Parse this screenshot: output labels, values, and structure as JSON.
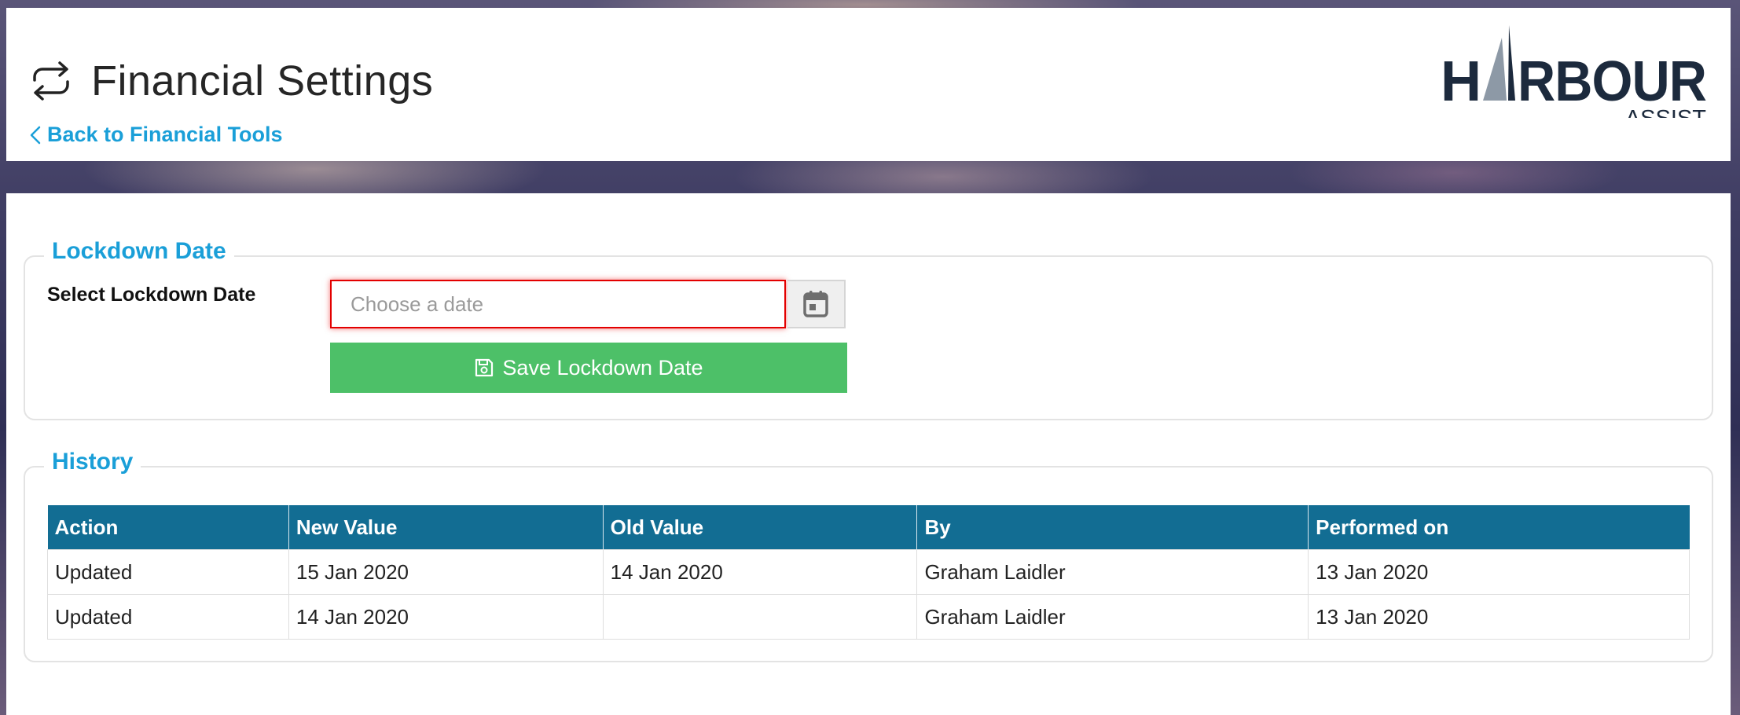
{
  "header": {
    "title": "Financial Settings",
    "title_icon": "repeat-arrows-icon",
    "back_link": "Back to Financial Tools"
  },
  "logo": {
    "main_text": "HARBOUR",
    "sub_text": "ASSIST",
    "colors": {
      "dark": "#1c2a3d",
      "sail": "#8d99a6"
    }
  },
  "lockdown": {
    "legend": "Lockdown Date",
    "field_label": "Select Lockdown Date",
    "date_placeholder": "Choose a date",
    "date_value": "",
    "calendar_icon": "calendar-icon",
    "save_label": "Save Lockdown Date",
    "save_icon": "floppy-disk-icon"
  },
  "history": {
    "legend": "History",
    "columns": [
      "Action",
      "New Value",
      "Old Value",
      "By",
      "Performed on"
    ],
    "rows": [
      [
        "Updated",
        "15 Jan 2020",
        "14 Jan 2020",
        "Graham Laidler",
        "13 Jan 2020"
      ],
      [
        "Updated",
        "14 Jan 2020",
        "",
        "Graham Laidler",
        "13 Jan 2020"
      ]
    ]
  },
  "colors": {
    "accent_blue": "#1a9fd8",
    "table_header": "#126d93",
    "save_green": "#4dc068",
    "error_red": "#e30000"
  }
}
